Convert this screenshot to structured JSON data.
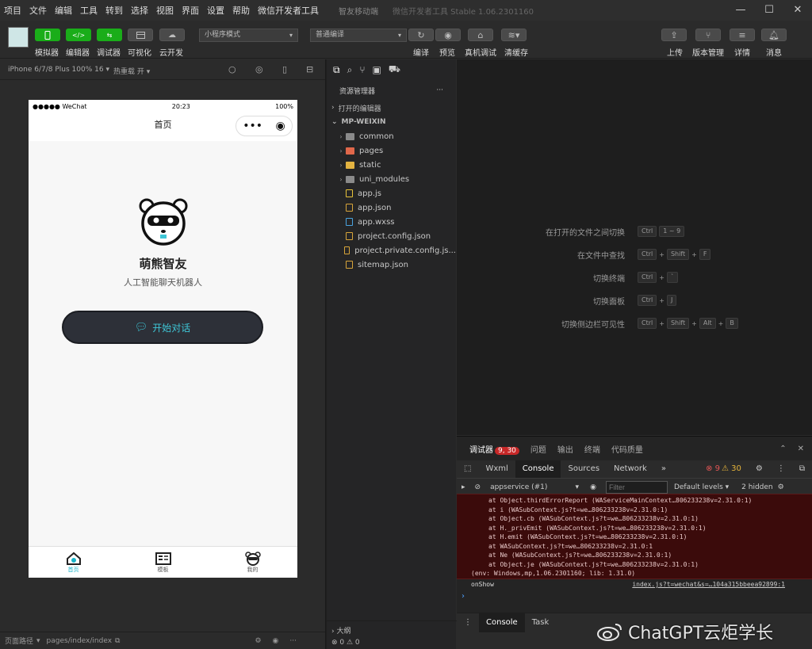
{
  "menu": [
    "项目",
    "文件",
    "编辑",
    "工具",
    "转到",
    "选择",
    "视图",
    "界面",
    "设置",
    "帮助",
    "微信开发者工具"
  ],
  "window_title": "智友移动端",
  "window_subtitle": "微信开发者工具 Stable 1.06.2301160",
  "toolbar": {
    "left_buttons": [
      {
        "label": "模拟器",
        "icon": "phone-icon"
      },
      {
        "label": "编辑器",
        "icon": "code-icon"
      },
      {
        "label": "调试器",
        "icon": "debug-icon"
      },
      {
        "label": "可视化",
        "icon": "layout-icon"
      },
      {
        "label": "云开发",
        "icon": "cloud-icon"
      }
    ],
    "mode_select": "小程序模式",
    "compile_select": "普通编译",
    "mid_buttons": [
      "编译",
      "预览",
      "真机调试",
      "清缓存"
    ],
    "right_buttons": [
      "上传",
      "版本管理",
      "详情",
      "消息"
    ]
  },
  "simulator": {
    "device": "iPhone 6/7/8 Plus 100% 16",
    "hotreload": "热重载 开",
    "status_carrier": "●●●●● WeChat",
    "status_time": "20:23",
    "status_battery": "100%",
    "nav_title": "首页",
    "app_name": "萌熊智友",
    "app_desc": "人工智能聊天机器人",
    "start_button": "开始对话",
    "tabs": [
      {
        "label": "首页",
        "icon": "home-icon",
        "active": true
      },
      {
        "label": "模板",
        "icon": "template-icon",
        "active": false
      },
      {
        "label": "我的",
        "icon": "bear-icon",
        "active": false
      }
    ],
    "page_path_label": "页面路径",
    "page_path": "pages/index/index"
  },
  "explorer": {
    "title": "资源管理器",
    "more": "···",
    "section_open": "打开的编辑器",
    "section_project": "MP-WEIXIN",
    "items": [
      {
        "name": "common",
        "type": "folder",
        "color": "#8a8a8a",
        "caret": "›"
      },
      {
        "name": "pages",
        "type": "folder",
        "color": "#e0674a",
        "caret": "›"
      },
      {
        "name": "static",
        "type": "folder",
        "color": "#e3b341",
        "caret": "›"
      },
      {
        "name": "uni_modules",
        "type": "folder",
        "color": "#8a8a8a",
        "caret": "›"
      },
      {
        "name": "app.js",
        "type": "js",
        "color": "#e8c33a",
        "caret": ""
      },
      {
        "name": "app.json",
        "type": "json",
        "color": "#d8a53a",
        "caret": ""
      },
      {
        "name": "app.wxss",
        "type": "wxss",
        "color": "#4aa3df",
        "caret": ""
      },
      {
        "name": "project.config.json",
        "type": "json",
        "color": "#d8a53a",
        "caret": ""
      },
      {
        "name": "project.private.config.js...",
        "type": "json",
        "color": "#d8a53a",
        "caret": ""
      },
      {
        "name": "sitemap.json",
        "type": "json",
        "color": "#d8a53a",
        "caret": ""
      }
    ],
    "outline": "大纲",
    "problems": "⊗ 0 ⚠ 0"
  },
  "shortcuts": [
    {
      "label": "在打开的文件之间切换",
      "keys": [
        "Ctrl",
        "1 ~ 9"
      ]
    },
    {
      "label": "在文件中查找",
      "keys": [
        "Ctrl",
        "+",
        "Shift",
        "+",
        "F"
      ]
    },
    {
      "label": "切换终端",
      "keys": [
        "Ctrl",
        "+",
        "`"
      ]
    },
    {
      "label": "切换面板",
      "keys": [
        "Ctrl",
        "+",
        "J"
      ]
    },
    {
      "label": "切换侧边栏可见性",
      "keys": [
        "Ctrl",
        "+",
        "Shift",
        "+",
        "Alt",
        "+",
        "B"
      ]
    }
  ],
  "devtools": {
    "tabs": [
      "调试器",
      "问题",
      "输出",
      "终端",
      "代码质量"
    ],
    "debug_badge": "9, 30",
    "panel_tabs": [
      "Wxml",
      "Console",
      "Sources",
      "Network"
    ],
    "more": "»",
    "err_count": "9",
    "warn_count": "30",
    "context": "appservice (#1)",
    "filter_placeholder": "Filter",
    "levels": "Default levels",
    "hidden": "2 hidden",
    "stack": [
      "at Object.thirdErrorReport (WAServiceMainContext…806233238v=2.31.0:1)",
      "at i (WASubContext.js?t=we…806233238v=2.31.0:1)",
      "at Object.cb (WASubContext.js?t=we…806233238v=2.31.0:1)",
      "at H._privEmit (WASubContext.js?t=we…806233238v=2.31.0:1)",
      "at H.emit (WASubContext.js?t=we…806233238v=2.31.0:1)",
      "at WASubContext.js?t=we…806233238v=2.31.0:1",
      "at Ne (WASubContext.js?t=we…806233238v=2.31.0:1)",
      "at Object.je (WASubContext.js?t=we…806233238v=2.31.0:1)"
    ],
    "env": "(env: Windows,mp,1.06.2301160; lib: 1.31.0)",
    "onshow": "onShow",
    "onshow_src": "index.js?t=wechat&s=…104a315bbeea92899:1",
    "bottom_tabs": [
      "Console",
      "Task"
    ]
  },
  "watermark": "ChatGPT云炬学长"
}
